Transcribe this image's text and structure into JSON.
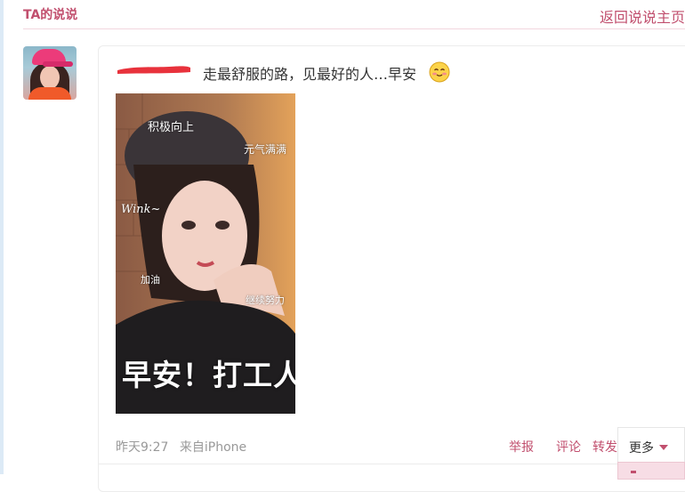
{
  "header": {
    "title": "TA的说说",
    "back_link": "返回说说主页"
  },
  "post": {
    "author_name": "",
    "text": "走最舒服的路，见最好的人…早安",
    "emoji": "smile-face",
    "photo": {
      "stickers": [
        "积极向上",
        "元气满满",
        "Wink~",
        "加油",
        "继续努力"
      ],
      "caption": "早安！打工人"
    },
    "time": "昨天9:27",
    "source": "来自iPhone"
  },
  "actions": {
    "report": "举报",
    "comment": "评论",
    "forward": "转发",
    "more": "更多"
  },
  "colors": {
    "accent": "#c14f6e",
    "redact": "#e8323c",
    "meta": "#999999"
  }
}
